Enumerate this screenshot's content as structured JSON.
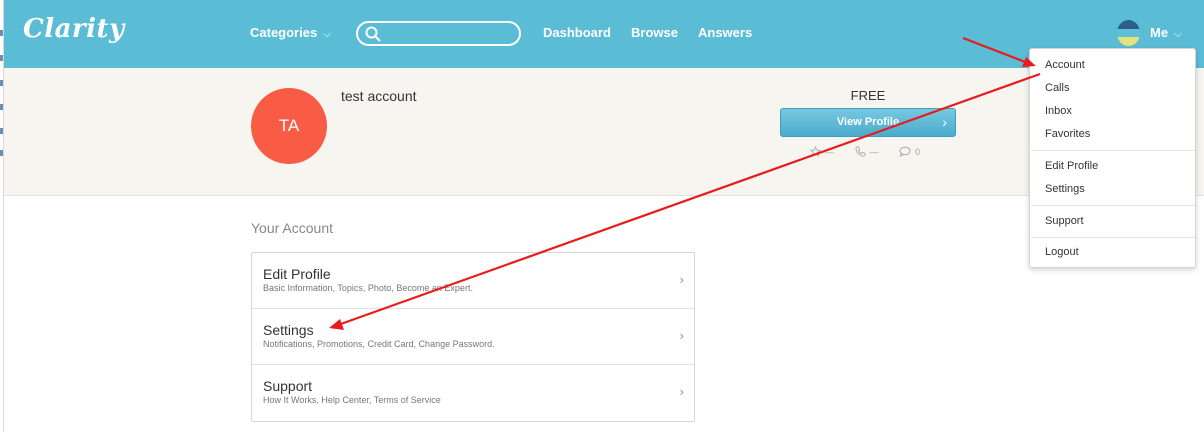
{
  "header": {
    "logo": "Clarity",
    "nav": [
      {
        "label": "Categories",
        "chevron": "⌵"
      },
      {
        "label": "Dashboard"
      },
      {
        "label": "Browse"
      },
      {
        "label": "Answers"
      }
    ],
    "search": {
      "placeholder": "",
      "value": ""
    },
    "user_menu": {
      "label": "Me",
      "chevron": "⌵"
    },
    "colors": {
      "bar": "#5bbcd6",
      "text": "#ffffff"
    }
  },
  "profile": {
    "initials": "TA",
    "name": "test account",
    "plan": "FREE",
    "view_profile_label": "View Profile",
    "view_profile_arrow": "›",
    "stats": {
      "rating": "—",
      "calls": "—",
      "messages": "0"
    },
    "avatar_color": "#f95c45"
  },
  "account": {
    "title": "Your Account",
    "items": [
      {
        "title": "Edit Profile",
        "subtitle": "Basic Information, Topics, Photo, Become an Expert.",
        "chevron": "›"
      },
      {
        "title": "Settings",
        "subtitle": "Notifications, Promotions, Credit Card, Change Password.",
        "chevron": "›"
      },
      {
        "title": "Support",
        "subtitle": "How It Works, Help Center, Terms of Service",
        "chevron": "›"
      }
    ]
  },
  "dropdown": {
    "items": [
      "Account",
      "Calls",
      "Inbox",
      "Favorites",
      "Edit Profile",
      "Settings",
      "Support",
      "Logout"
    ]
  },
  "annotation_color": "#e81c1c"
}
